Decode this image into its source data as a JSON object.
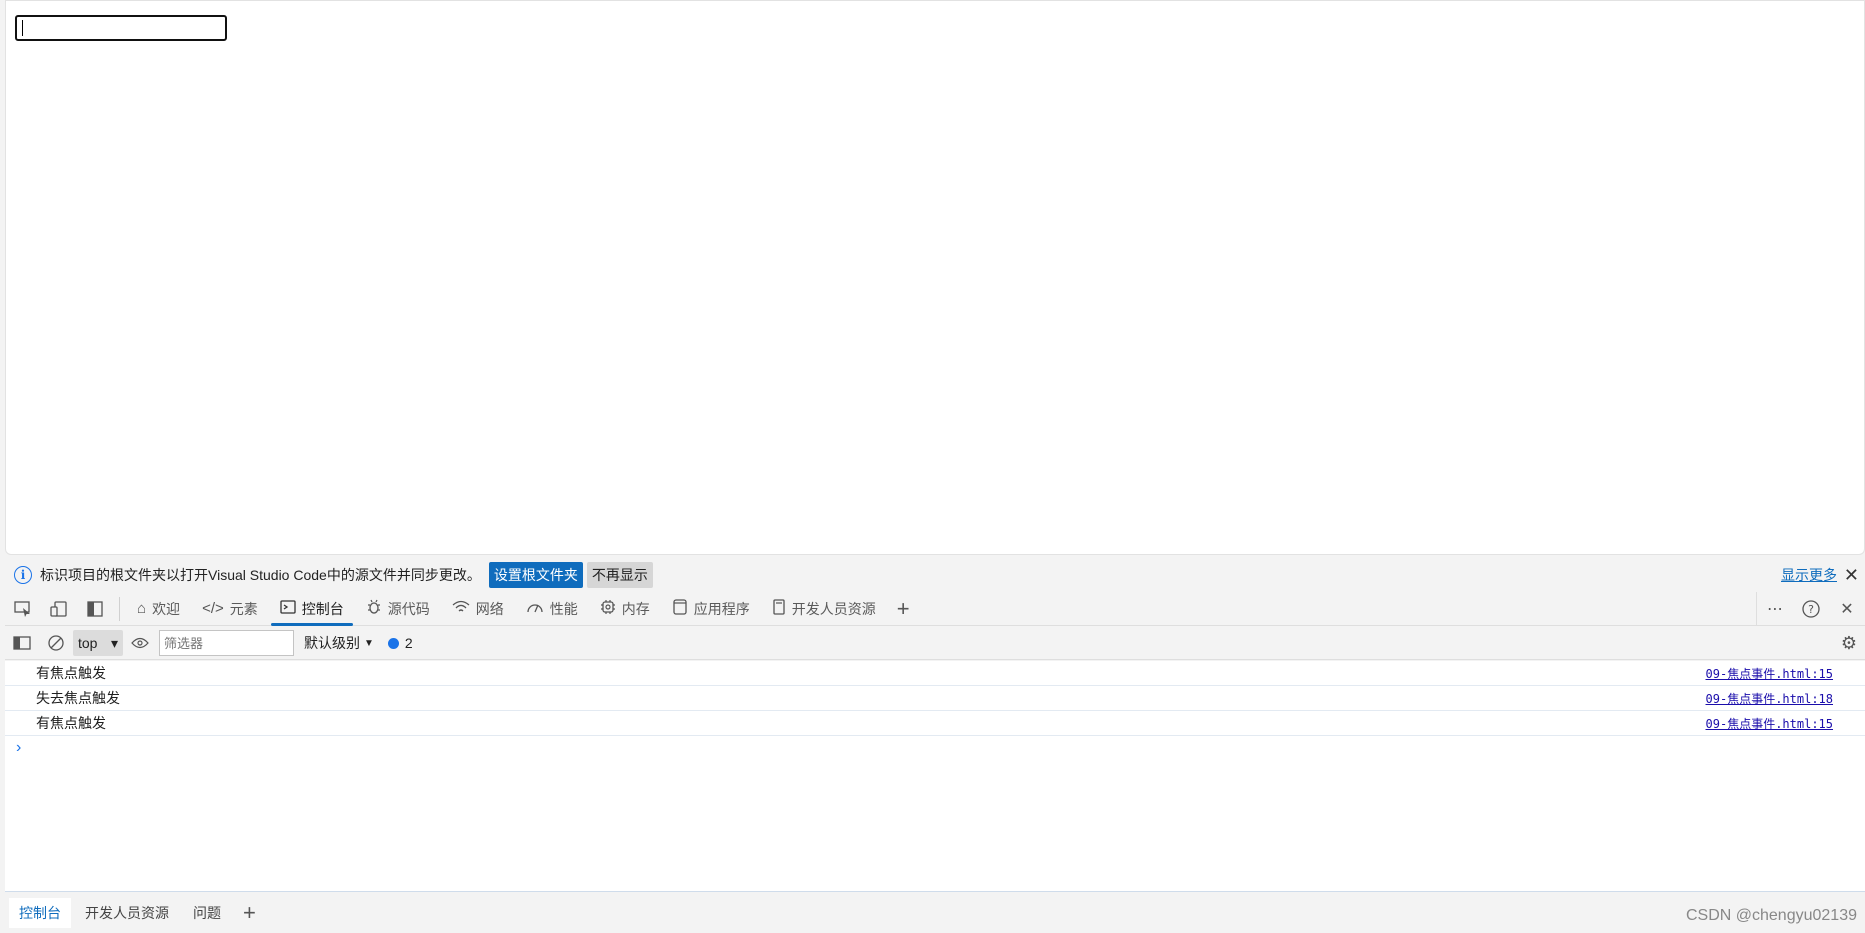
{
  "viewport": {
    "input_value": ""
  },
  "infobar": {
    "message": "标识项目的根文件夹以打开Visual Studio Code中的源文件并同步更改。",
    "primary_button": "设置根文件夹",
    "secondary_button": "不再显示",
    "show_more": "显示更多"
  },
  "tabs": [
    {
      "label": "欢迎",
      "icon": "home-icon"
    },
    {
      "label": "元素",
      "icon": "code-icon"
    },
    {
      "label": "控制台",
      "icon": "console-icon",
      "active": true
    },
    {
      "label": "源代码",
      "icon": "bug-icon"
    },
    {
      "label": "网络",
      "icon": "wifi-icon"
    },
    {
      "label": "性能",
      "icon": "gauge-icon"
    },
    {
      "label": "内存",
      "icon": "chip-icon"
    },
    {
      "label": "应用程序",
      "icon": "app-icon"
    },
    {
      "label": "开发人员资源",
      "icon": "document-icon"
    }
  ],
  "console_toolbar": {
    "context": "top",
    "filter_placeholder": "筛选器",
    "level": "默认级别",
    "message_count": "2"
  },
  "logs": [
    {
      "text": "有焦点触发",
      "source": "09-焦点事件.html:15"
    },
    {
      "text": "失去焦点触发",
      "source": "09-焦点事件.html:18"
    },
    {
      "text": "有焦点触发",
      "source": "09-焦点事件.html:15"
    }
  ],
  "drawer_tabs": [
    "控制台",
    "开发人员资源",
    "问题"
  ],
  "watermark": "CSDN @chengyu02139",
  "colors": {
    "accent": "#0f6cbd",
    "link": "#1a0dab"
  }
}
